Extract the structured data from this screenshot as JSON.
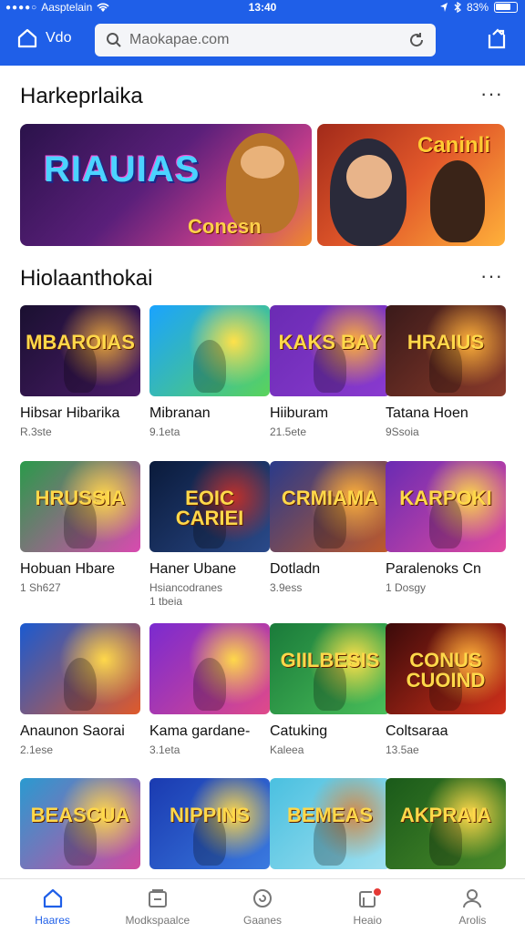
{
  "status": {
    "carrier": "Aasptelain",
    "time": "13:40",
    "battery": "83%"
  },
  "header": {
    "home_label": "Vdo",
    "search_value": "Maokapae.com"
  },
  "section1": {
    "title": "Harkeprlaika",
    "banners": [
      {
        "text": "RIAUIAS",
        "subtext": "Conesn",
        "tag": ""
      },
      {
        "text": "",
        "subtext": "",
        "tag": "Caninli"
      }
    ]
  },
  "section2": {
    "title": "Hiolaanthokai",
    "cards": [
      {
        "title": "Hibsar Hibarika",
        "sub": "R.3ste",
        "sub2": "",
        "thumb_text": "MBAROIAS",
        "colors": [
          "#1a1030",
          "#4b1b6a",
          "#e3a23a"
        ]
      },
      {
        "title": "Mibranan",
        "sub": "9.1eta",
        "sub2": "",
        "thumb_text": "",
        "colors": [
          "#1aa3ff",
          "#5ad35a",
          "#ffe14a"
        ]
      },
      {
        "title": "Hiiburam",
        "sub": "21.5ete",
        "sub2": "",
        "thumb_text": "KAKS BAY",
        "colors": [
          "#6a2bb3",
          "#8a3ad0",
          "#ffb13a"
        ]
      },
      {
        "title": "Tatana Hoen",
        "sub": "9Ssoia",
        "sub2": "",
        "thumb_text": "HRAIUS",
        "colors": [
          "#3a1a1a",
          "#8a3a2a",
          "#ffb13a"
        ]
      },
      {
        "title": "Hobuan Hbare",
        "sub": "1 Sh627",
        "sub2": "",
        "thumb_text": "HRUSSIA",
        "colors": [
          "#2a9a4a",
          "#d94ab0",
          "#ffd84a"
        ]
      },
      {
        "title": "Haner Ubane",
        "sub": "Hsiancodranes",
        "sub2": "1 tbeia",
        "thumb_text": "EOIC CARIEI",
        "colors": [
          "#0a1a3a",
          "#2a4a8a",
          "#c0302a"
        ]
      },
      {
        "title": "Dotladn",
        "sub": "3.9ess",
        "sub2": "",
        "thumb_text": "CRMIAMA",
        "colors": [
          "#2a3a8a",
          "#c05a2a",
          "#ffb13a"
        ]
      },
      {
        "title": "Paralenoks Cn",
        "sub": "1 Dosgy",
        "sub2": "",
        "thumb_text": "KARPOKI",
        "colors": [
          "#6a2bb3",
          "#e04aa0",
          "#ffd84a"
        ]
      },
      {
        "title": "Anaunon Saorai",
        "sub": "2.1ese",
        "sub2": "",
        "thumb_text": "",
        "colors": [
          "#1a5ad0",
          "#e05a2a",
          "#ffd84a"
        ]
      },
      {
        "title": "Kama gardane-",
        "sub": "3.1eta",
        "sub2": "",
        "thumb_text": "",
        "colors": [
          "#7a2ad0",
          "#e04a8a",
          "#ffd84a"
        ]
      },
      {
        "title": "Catuking",
        "sub": "Kaleea",
        "sub2": "",
        "thumb_text": "GIILBESIS",
        "colors": [
          "#1a7a3a",
          "#4ac05a",
          "#ffe14a"
        ]
      },
      {
        "title": "Coltsaraa",
        "sub": "13.5ae",
        "sub2": "",
        "thumb_text": "CONUS CUOIND",
        "colors": [
          "#3a0a0a",
          "#d0301a",
          "#ffb13a"
        ]
      },
      {
        "title": "",
        "sub": "",
        "sub2": "",
        "thumb_text": "BEASCUA",
        "colors": [
          "#2a9ad0",
          "#d04aa0",
          "#ffd84a"
        ]
      },
      {
        "title": "",
        "sub": "",
        "sub2": "",
        "thumb_text": "NIPPINS",
        "colors": [
          "#1a3ab0",
          "#3a7ae0",
          "#ffd84a"
        ]
      },
      {
        "title": "",
        "sub": "",
        "sub2": "",
        "thumb_text": "BEMEAS",
        "colors": [
          "#4ac0e0",
          "#a0e0f0",
          "#d08a4a"
        ]
      },
      {
        "title": "",
        "sub": "",
        "sub2": "",
        "thumb_text": "AKPRAIA",
        "colors": [
          "#1a5a1a",
          "#4a8a2a",
          "#ffd84a"
        ]
      }
    ]
  },
  "tabs": [
    {
      "label": "Haares",
      "icon": "home-icon"
    },
    {
      "label": "Modkspaalce",
      "icon": "store-icon"
    },
    {
      "label": "Gaanes",
      "icon": "games-icon"
    },
    {
      "label": "Heaio",
      "icon": "inbox-icon"
    },
    {
      "label": "Arolis",
      "icon": "profile-icon"
    }
  ]
}
